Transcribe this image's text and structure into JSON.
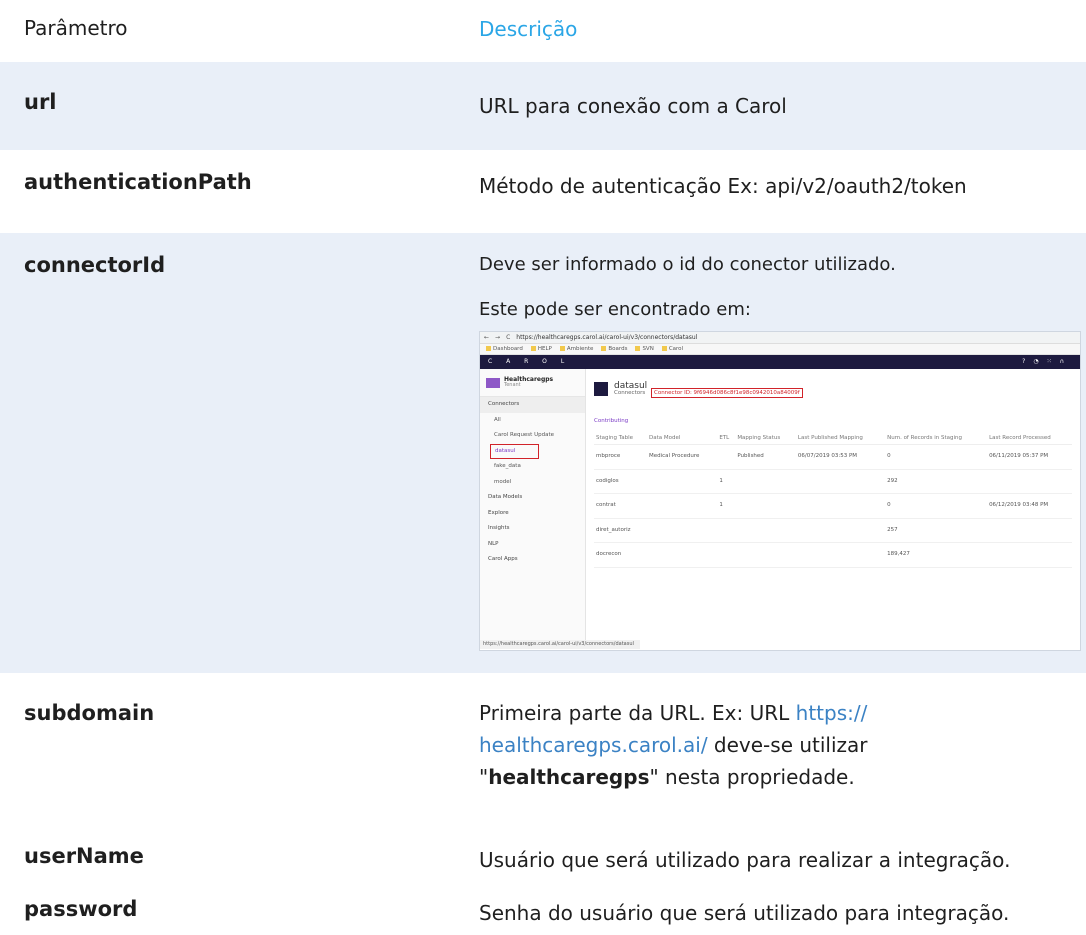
{
  "header": {
    "col1": "Parâmetro",
    "col2": "Descrição"
  },
  "rows": {
    "url": {
      "name": "url",
      "desc": "URL para conexão com a Carol"
    },
    "auth": {
      "name": "authenticationPath",
      "desc": "Método de autenticação Ex: api/v2/oauth2/token"
    },
    "conn": {
      "name": "connectorId",
      "desc1": "Deve ser informado o id do conector utilizado.",
      "desc2": "Este pode ser encontrado em:"
    },
    "sub": {
      "name": "subdomain",
      "desc_a": "Primeira parte da URL. Ex: URL ",
      "link": "https:// healthcaregps.carol.ai/",
      "desc_b": " deve-se utilizar \"",
      "bold": "healthcaregps",
      "desc_c": "\" nesta propriedade."
    },
    "user": {
      "name": "userName",
      "desc": "Usuário que será utilizado para realizar a integração."
    },
    "pass": {
      "name": "password",
      "desc": "Senha do usuário que será utilizado para integração."
    }
  },
  "screenshot": {
    "url": "https://healthcaregps.carol.ai/carol-ui/v3/connectors/datasul",
    "bookmarks": [
      "Dashboard",
      "HELP",
      "Ambiente",
      "Boards",
      "SVN",
      "Carol"
    ],
    "app_logo": "C A R O L",
    "tenant_name": "Healthcaregps",
    "tenant_sub": "Tenant",
    "nav_connectors": "Connectors",
    "sub_items": [
      "All",
      "Carol Request Update",
      "datasul",
      "fake_data",
      "model"
    ],
    "nav_items": [
      "Data Models",
      "Explore",
      "Insights",
      "NLP",
      "Carol Apps"
    ],
    "connector_name": "datasul",
    "connector_tab": "Connectors",
    "connector_id": "Connector ID: 9f6946d086c8f1e98c0942010a84009f",
    "contributing": "Contributing",
    "columns": [
      "Staging Table",
      "Data Model",
      "ETL",
      "Mapping Status",
      "Last Published Mapping",
      "Num. of Records in Staging",
      "Last Record Processed"
    ],
    "table_rows": [
      [
        "mbproce",
        "Medical Procedure",
        "",
        "Published",
        "06/07/2019 03:53 PM",
        "0",
        "06/11/2019 05:37 PM"
      ],
      [
        "codiglos",
        "",
        "1",
        "",
        "",
        "292",
        ""
      ],
      [
        "contrat",
        "",
        "1",
        "",
        "",
        "0",
        "06/12/2019 03:48 PM"
      ],
      [
        "diret_autoriz",
        "",
        "",
        "",
        "",
        "257",
        ""
      ],
      [
        "docrecon",
        "",
        "",
        "",
        "",
        "189,427",
        ""
      ]
    ],
    "status_url": "https://healthcaregps.carol.ai/carol-ui/v3/connectors/datasul"
  }
}
